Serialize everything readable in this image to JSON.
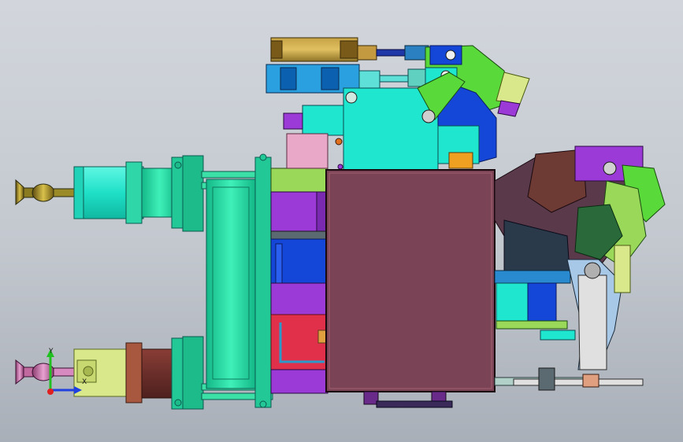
{
  "viewport": {
    "background_top": "#d2d6dc",
    "background_bottom": "#a9afb8"
  },
  "triad": {
    "y_label": "Y",
    "x_label": "X",
    "y_color": "#20c020",
    "x_color": "#2040e0",
    "origin_color": "#e02020"
  },
  "palette": {
    "body_brown": "#7b4456",
    "frame_teal": "#1ecf9a",
    "cylinder_cyan": "#1fe7cf",
    "purple": "#9b3ad6",
    "blue": "#1447d8",
    "green": "#59d93a",
    "red": "#e0304a",
    "khaki": "#d9d98a",
    "brass": "#b89a44",
    "dark_brown": "#6e3a34"
  }
}
